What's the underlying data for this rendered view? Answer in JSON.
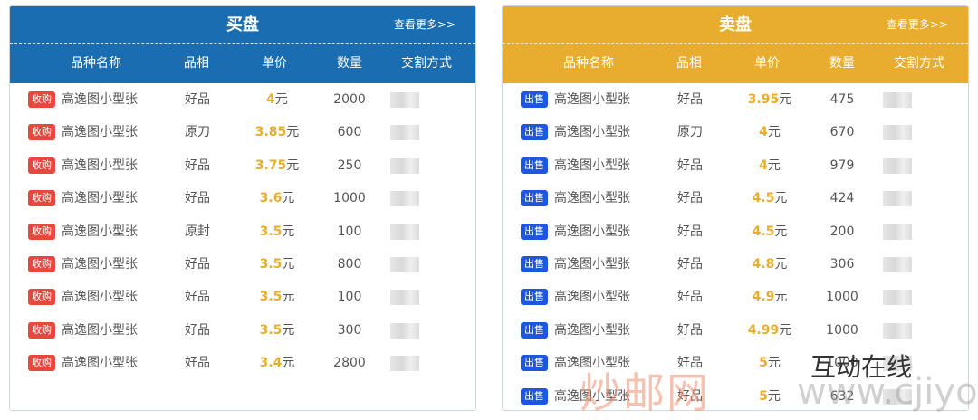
{
  "buy": {
    "title": "买盘",
    "more": "查看更多>>",
    "cols": [
      "品种名称",
      "品相",
      "单价",
      "数量",
      "交割方式"
    ],
    "rows": [
      {
        "badge": "收购",
        "name": "高逸图小型张",
        "grade": "好品",
        "price": "4",
        "unit": "元",
        "qty": "2000"
      },
      {
        "badge": "收购",
        "name": "高逸图小型张",
        "grade": "原刀",
        "price": "3.85",
        "unit": "元",
        "qty": "600"
      },
      {
        "badge": "收购",
        "name": "高逸图小型张",
        "grade": "好品",
        "price": "3.75",
        "unit": "元",
        "qty": "250"
      },
      {
        "badge": "收购",
        "name": "高逸图小型张",
        "grade": "好品",
        "price": "3.6",
        "unit": "元",
        "qty": "1000"
      },
      {
        "badge": "收购",
        "name": "高逸图小型张",
        "grade": "原封",
        "price": "3.5",
        "unit": "元",
        "qty": "100"
      },
      {
        "badge": "收购",
        "name": "高逸图小型张",
        "grade": "好品",
        "price": "3.5",
        "unit": "元",
        "qty": "800"
      },
      {
        "badge": "收购",
        "name": "高逸图小型张",
        "grade": "好品",
        "price": "3.5",
        "unit": "元",
        "qty": "100"
      },
      {
        "badge": "收购",
        "name": "高逸图小型张",
        "grade": "好品",
        "price": "3.5",
        "unit": "元",
        "qty": "300"
      },
      {
        "badge": "收购",
        "name": "高逸图小型张",
        "grade": "好品",
        "price": "3.4",
        "unit": "元",
        "qty": "2800"
      }
    ]
  },
  "sell": {
    "title": "卖盘",
    "more": "查看更多>>",
    "cols": [
      "品种名称",
      "品相",
      "单价",
      "数量",
      "交割方式"
    ],
    "rows": [
      {
        "badge": "出售",
        "name": "高逸图小型张",
        "grade": "好品",
        "price": "3.95",
        "unit": "元",
        "qty": "475"
      },
      {
        "badge": "出售",
        "name": "高逸图小型张",
        "grade": "原刀",
        "price": "4",
        "unit": "元",
        "qty": "670"
      },
      {
        "badge": "出售",
        "name": "高逸图小型张",
        "grade": "好品",
        "price": "4",
        "unit": "元",
        "qty": "979"
      },
      {
        "badge": "出售",
        "name": "高逸图小型张",
        "grade": "好品",
        "price": "4.5",
        "unit": "元",
        "qty": "424"
      },
      {
        "badge": "出售",
        "name": "高逸图小型张",
        "grade": "好品",
        "price": "4.5",
        "unit": "元",
        "qty": "200"
      },
      {
        "badge": "出售",
        "name": "高逸图小型张",
        "grade": "好品",
        "price": "4.8",
        "unit": "元",
        "qty": "306"
      },
      {
        "badge": "出售",
        "name": "高逸图小型张",
        "grade": "好品",
        "price": "4.9",
        "unit": "元",
        "qty": "1000"
      },
      {
        "badge": "出售",
        "name": "高逸图小型张",
        "grade": "好品",
        "price": "4.99",
        "unit": "元",
        "qty": "1000"
      },
      {
        "badge": "出售",
        "name": "高逸图小型张",
        "grade": "好品",
        "price": "5",
        "unit": "元",
        "qty": "1000"
      },
      {
        "badge": "出售",
        "name": "高逸图小型张",
        "grade": "好品",
        "price": "5",
        "unit": "元",
        "qty": "632"
      }
    ]
  },
  "watermark": {
    "site_cn": "炒邮网",
    "site_url": "www.cjiyou.net",
    "account": "互动在线"
  },
  "colors": {
    "buy_header": "#1a6db0",
    "sell_header": "#e8ad2e",
    "buy_badge": "#e8473d",
    "sell_badge": "#1f56e0",
    "price": "#e8ad2e"
  }
}
